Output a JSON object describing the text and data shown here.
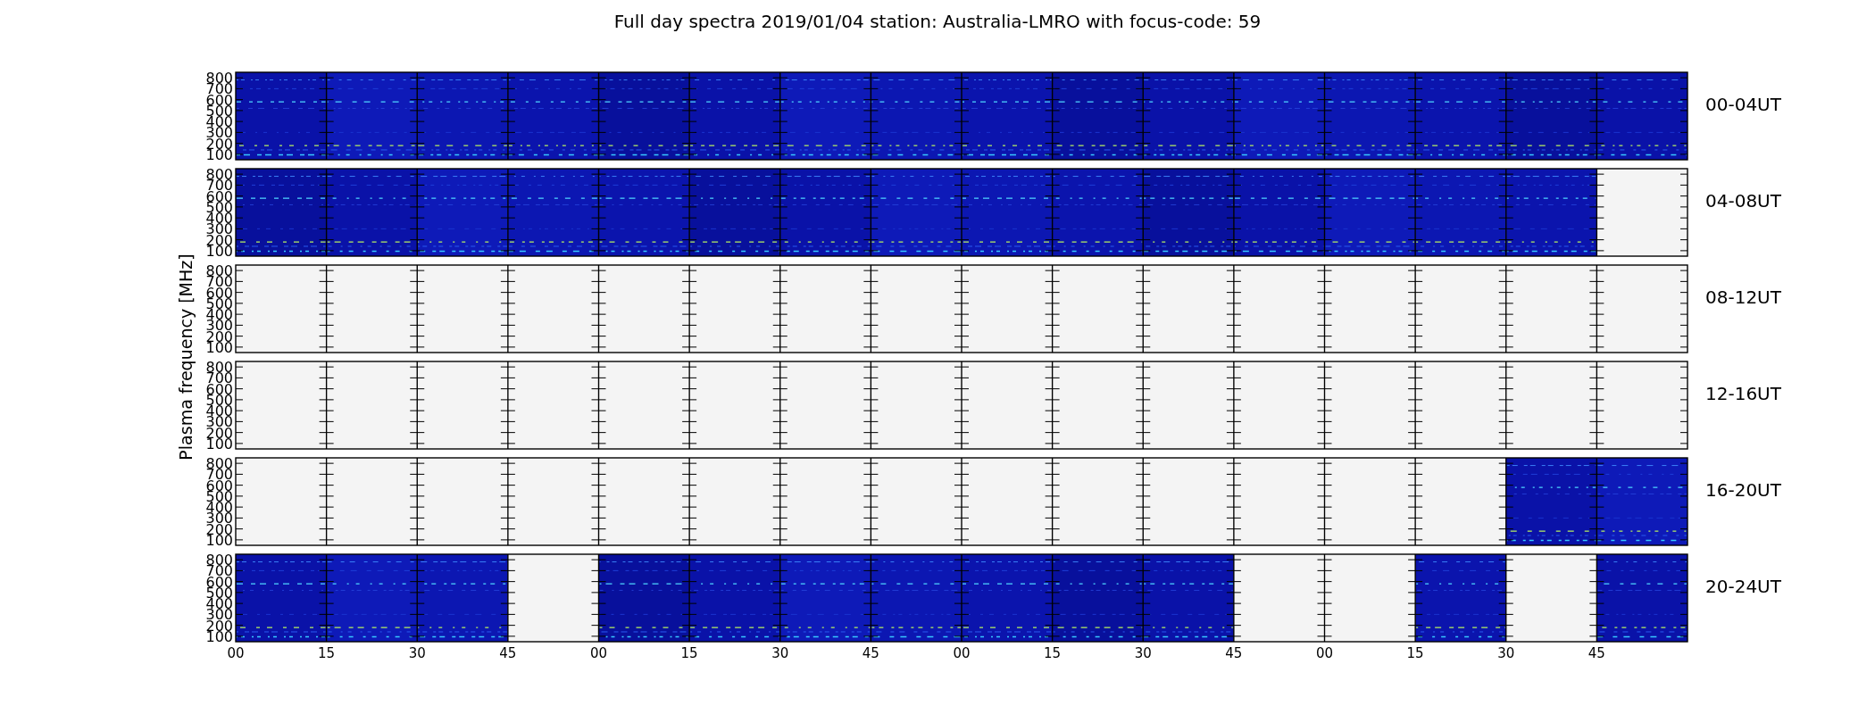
{
  "title": "Full day spectra 2019/01/04 station: Australia-LMRO with focus-code: 59",
  "y_axis": {
    "label": "Plasma frequency [MHz]"
  },
  "panels": [
    {
      "label": "00-04UT",
      "y_ticks": [
        "800",
        "700",
        "600",
        "500",
        "400",
        "300",
        "200",
        "100"
      ],
      "segments": [
        {
          "has_data": true
        },
        {
          "has_data": true
        },
        {
          "has_data": true
        },
        {
          "has_data": true
        },
        {
          "has_data": true
        },
        {
          "has_data": true
        },
        {
          "has_data": true
        },
        {
          "has_data": true
        },
        {
          "has_data": true
        },
        {
          "has_data": true
        },
        {
          "has_data": true
        },
        {
          "has_data": true
        },
        {
          "has_data": true
        },
        {
          "has_data": true
        },
        {
          "has_data": true
        },
        {
          "has_data": true
        }
      ]
    },
    {
      "label": "04-08UT",
      "y_ticks": [
        "800",
        "700",
        "600",
        "500",
        "400",
        "300",
        "200",
        "100"
      ],
      "segments": [
        {
          "has_data": true
        },
        {
          "has_data": true
        },
        {
          "has_data": true
        },
        {
          "has_data": true
        },
        {
          "has_data": true
        },
        {
          "has_data": true
        },
        {
          "has_data": true
        },
        {
          "has_data": true
        },
        {
          "has_data": true
        },
        {
          "has_data": true
        },
        {
          "has_data": true
        },
        {
          "has_data": true
        },
        {
          "has_data": true
        },
        {
          "has_data": true
        },
        {
          "has_data": true
        },
        {
          "has_data": false
        }
      ]
    },
    {
      "label": "08-12UT",
      "y_ticks": [
        "800",
        "700",
        "600",
        "500",
        "400",
        "300",
        "200",
        "100"
      ],
      "segments": [
        {
          "has_data": false
        },
        {
          "has_data": false
        },
        {
          "has_data": false
        },
        {
          "has_data": false
        },
        {
          "has_data": false
        },
        {
          "has_data": false
        },
        {
          "has_data": false
        },
        {
          "has_data": false
        },
        {
          "has_data": false
        },
        {
          "has_data": false
        },
        {
          "has_data": false
        },
        {
          "has_data": false
        },
        {
          "has_data": false
        },
        {
          "has_data": false
        },
        {
          "has_data": false
        },
        {
          "has_data": false
        }
      ]
    },
    {
      "label": "12-16UT",
      "y_ticks": [
        "800",
        "700",
        "600",
        "500",
        "400",
        "300",
        "200",
        "100"
      ],
      "segments": [
        {
          "has_data": false
        },
        {
          "has_data": false
        },
        {
          "has_data": false
        },
        {
          "has_data": false
        },
        {
          "has_data": false
        },
        {
          "has_data": false
        },
        {
          "has_data": false
        },
        {
          "has_data": false
        },
        {
          "has_data": false
        },
        {
          "has_data": false
        },
        {
          "has_data": false
        },
        {
          "has_data": false
        },
        {
          "has_data": false
        },
        {
          "has_data": false
        },
        {
          "has_data": false
        },
        {
          "has_data": false
        }
      ]
    },
    {
      "label": "16-20UT",
      "y_ticks": [
        "800",
        "700",
        "600",
        "500",
        "400",
        "300",
        "200",
        "100"
      ],
      "segments": [
        {
          "has_data": false
        },
        {
          "has_data": false
        },
        {
          "has_data": false
        },
        {
          "has_data": false
        },
        {
          "has_data": false
        },
        {
          "has_data": false
        },
        {
          "has_data": false
        },
        {
          "has_data": false
        },
        {
          "has_data": false
        },
        {
          "has_data": false
        },
        {
          "has_data": false
        },
        {
          "has_data": false
        },
        {
          "has_data": false
        },
        {
          "has_data": false
        },
        {
          "has_data": true
        },
        {
          "has_data": true
        }
      ]
    },
    {
      "label": "20-24UT",
      "y_ticks": [
        "800",
        "700",
        "600",
        "500",
        "400",
        "300",
        "200",
        "100"
      ],
      "segments": [
        {
          "has_data": true
        },
        {
          "has_data": true
        },
        {
          "has_data": true
        },
        {
          "has_data": false
        },
        {
          "has_data": true
        },
        {
          "has_data": true
        },
        {
          "has_data": true
        },
        {
          "has_data": true
        },
        {
          "has_data": true
        },
        {
          "has_data": true
        },
        {
          "has_data": true
        },
        {
          "has_data": false
        },
        {
          "has_data": false
        },
        {
          "has_data": true
        },
        {
          "has_data": false
        },
        {
          "has_data": true
        }
      ]
    }
  ],
  "x_axis": {
    "ticks": [
      "00",
      "15",
      "30",
      "45",
      "00",
      "15",
      "30",
      "45",
      "00",
      "15",
      "30",
      "45",
      "00",
      "15",
      "30",
      "45"
    ]
  }
}
